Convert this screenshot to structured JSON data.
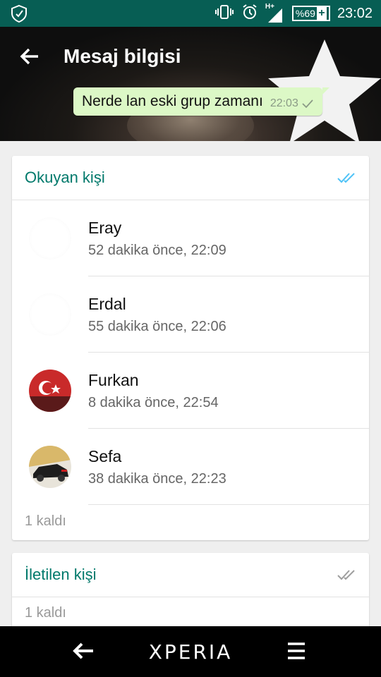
{
  "status_bar": {
    "time": "23:02",
    "battery": "%69",
    "network": "H+"
  },
  "header": {
    "title": "Mesaj bilgisi"
  },
  "message": {
    "text": "Nerde lan eski grup zamanı",
    "time": "22:03"
  },
  "read_section": {
    "title": "Okuyan kişi",
    "people": [
      {
        "name": "Eray",
        "time": "52 dakika önce, 22:09"
      },
      {
        "name": "Erdal",
        "time": "55 dakika önce, 22:06"
      },
      {
        "name": "Furkan",
        "time": "8 dakika önce, 22:54"
      },
      {
        "name": "Sefa",
        "time": "38 dakika önce, 22:23"
      }
    ],
    "remaining": "1 kaldı"
  },
  "delivered_section": {
    "title": "İletilen kişi",
    "remaining": "1 kaldı"
  },
  "nav": {
    "brand": "XPERIA"
  },
  "colors": {
    "status_bar": "#075e54",
    "accent": "#00796b",
    "bubble": "#dcf8c6",
    "read_tick": "#4fc3f7",
    "delivered_tick": "#9e9e9e"
  }
}
